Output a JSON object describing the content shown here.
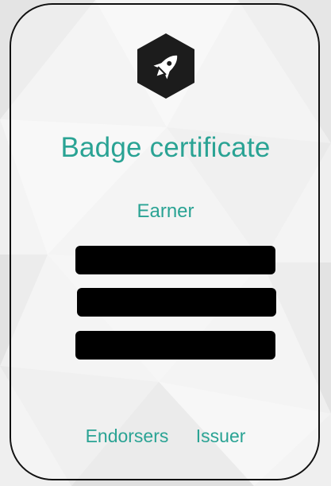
{
  "badge": {
    "icon": "rocket-icon",
    "icon_bg": "#1c1c1c",
    "icon_fg": "#ffffff"
  },
  "title": "Badge certificate",
  "earner_label": "Earner",
  "redacted_lines": 3,
  "links": {
    "endorsers": "Endorsers",
    "issuer": "Issuer"
  },
  "colors": {
    "accent": "#2aa394",
    "border": "#111111",
    "redaction": "#000000"
  }
}
